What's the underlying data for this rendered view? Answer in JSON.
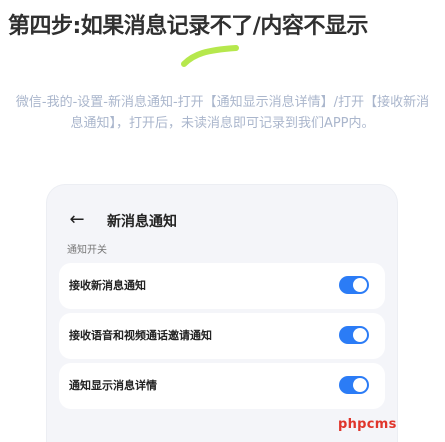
{
  "title": "第四步:如果消息记录不了/内容不显示",
  "instructions": "微信-我的-设置-新消息通知-打开【通知显示消息详情】/打开【接收新消息通知】，打开后，未读消息即可记录到我们APP内。",
  "settings_screen": {
    "back_icon": "←",
    "header_title": "新消息通知",
    "section_label": "通知开关",
    "rows": [
      {
        "label": "接收新消息通知",
        "toggle_on": true
      },
      {
        "label": "接收语音和视频通话邀请通知",
        "toggle_on": true
      },
      {
        "label": "通知显示消息详情",
        "toggle_on": true
      }
    ]
  },
  "watermark": "phpcms",
  "colors": {
    "accent": "#2b7cf6",
    "highlight": "#b6e84d",
    "watermark": "#e0352b"
  }
}
